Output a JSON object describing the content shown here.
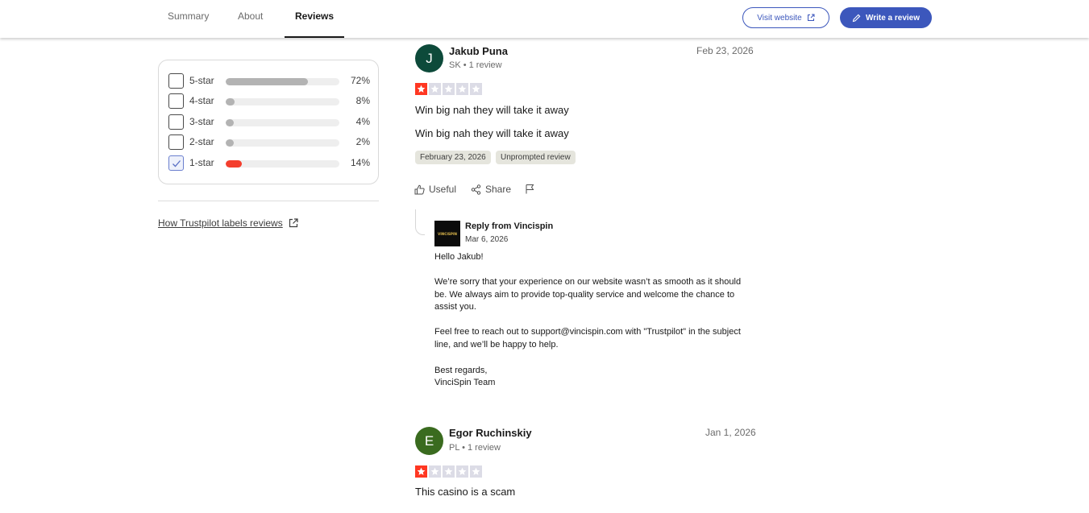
{
  "nav": {
    "tabs": [
      {
        "label": "Summary"
      },
      {
        "label": "About"
      },
      {
        "label": "Reviews"
      }
    ],
    "visit_website": "Visit website",
    "write_review": "Write a review"
  },
  "colors": {
    "brand_blue": "#3c57bc",
    "star_red": "#ff3722",
    "bar_gray": "#b3b3b3",
    "bar_red": "#f43e2d"
  },
  "filters": [
    {
      "label": "5-star",
      "pct": "72%",
      "value": 72,
      "checked": false
    },
    {
      "label": "4-star",
      "pct": "8%",
      "value": 8,
      "checked": false
    },
    {
      "label": "3-star",
      "pct": "4%",
      "value": 4,
      "checked": false
    },
    {
      "label": "2-star",
      "pct": "2%",
      "value": 2,
      "checked": false
    },
    {
      "label": "1-star",
      "pct": "14%",
      "value": 14,
      "checked": true
    }
  ],
  "labels_link": "How Trustpilot labels reviews",
  "reviews": [
    {
      "initial": "J",
      "avatar_color": "#0d4a3a",
      "name": "Jakub Puna",
      "meta": "SK • 1 review",
      "date": "Feb 23, 2026",
      "rating": 1,
      "title": "Win big nah they will take it away",
      "body": "Win big nah they will take it away",
      "tags": [
        "February 23, 2026",
        "Unprompted review"
      ],
      "actions": {
        "useful": "Useful",
        "share": "Share"
      },
      "reply": {
        "logo_text": "VINCISPIN",
        "from": "Reply from Vincispin",
        "date": "Mar 6, 2026",
        "p1": "Hello Jakub!",
        "p2": "We’re sorry that your experience on our website wasn’t as smooth as it should be. We always aim to provide top-quality service and welcome the chance to assist you.",
        "p3": "Feel free to reach out to support@vincispin.com with \"Trustpilot\" in the subject line, and we’ll be happy to help.",
        "p4a": "Best regards,",
        "p4b": "VinciSpin Team"
      }
    },
    {
      "initial": "E",
      "avatar_color": "#3a6b1f",
      "name": "Egor Ruchinskiy",
      "meta": "PL • 1 review",
      "date": "Jan 1, 2026",
      "rating": 1,
      "title": "This casino is a scam"
    }
  ]
}
